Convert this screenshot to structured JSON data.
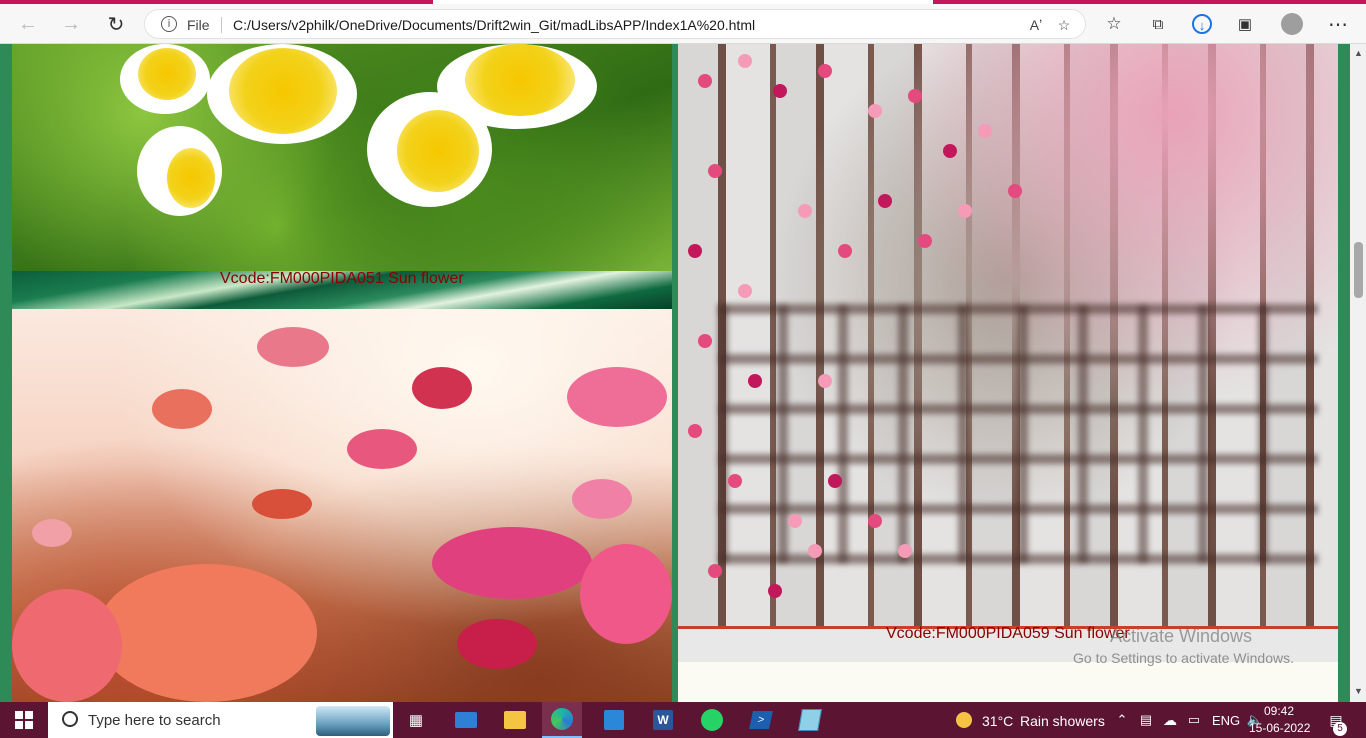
{
  "browser": {
    "file_label": "File",
    "url": "C:/Users/v2philk/OneDrive/Documents/Drift2win_Git/madLibsAPP/Index1A%20.html",
    "read_aloud_glyph": "Aʼ"
  },
  "page": {
    "captions": [
      "Vcode:FM000PIDA051 Sun flower",
      "Vcode:FM000PIDA059 Sun flower"
    ],
    "watermark": {
      "line1": "Activate Windows",
      "line2": "Go to Settings to activate Windows."
    }
  },
  "taskbar": {
    "search_placeholder": "Type here to search",
    "weather_temp": "31°C",
    "weather_desc": "Rain showers",
    "language": "ENG",
    "time": "09:42",
    "date": "15-06-2022",
    "notification_count": "5"
  },
  "colors": {
    "tab_accent": "#c2185b",
    "page_background": "#2e8b57",
    "caption_text": "#8b0000",
    "taskbar": "#5b1432"
  }
}
